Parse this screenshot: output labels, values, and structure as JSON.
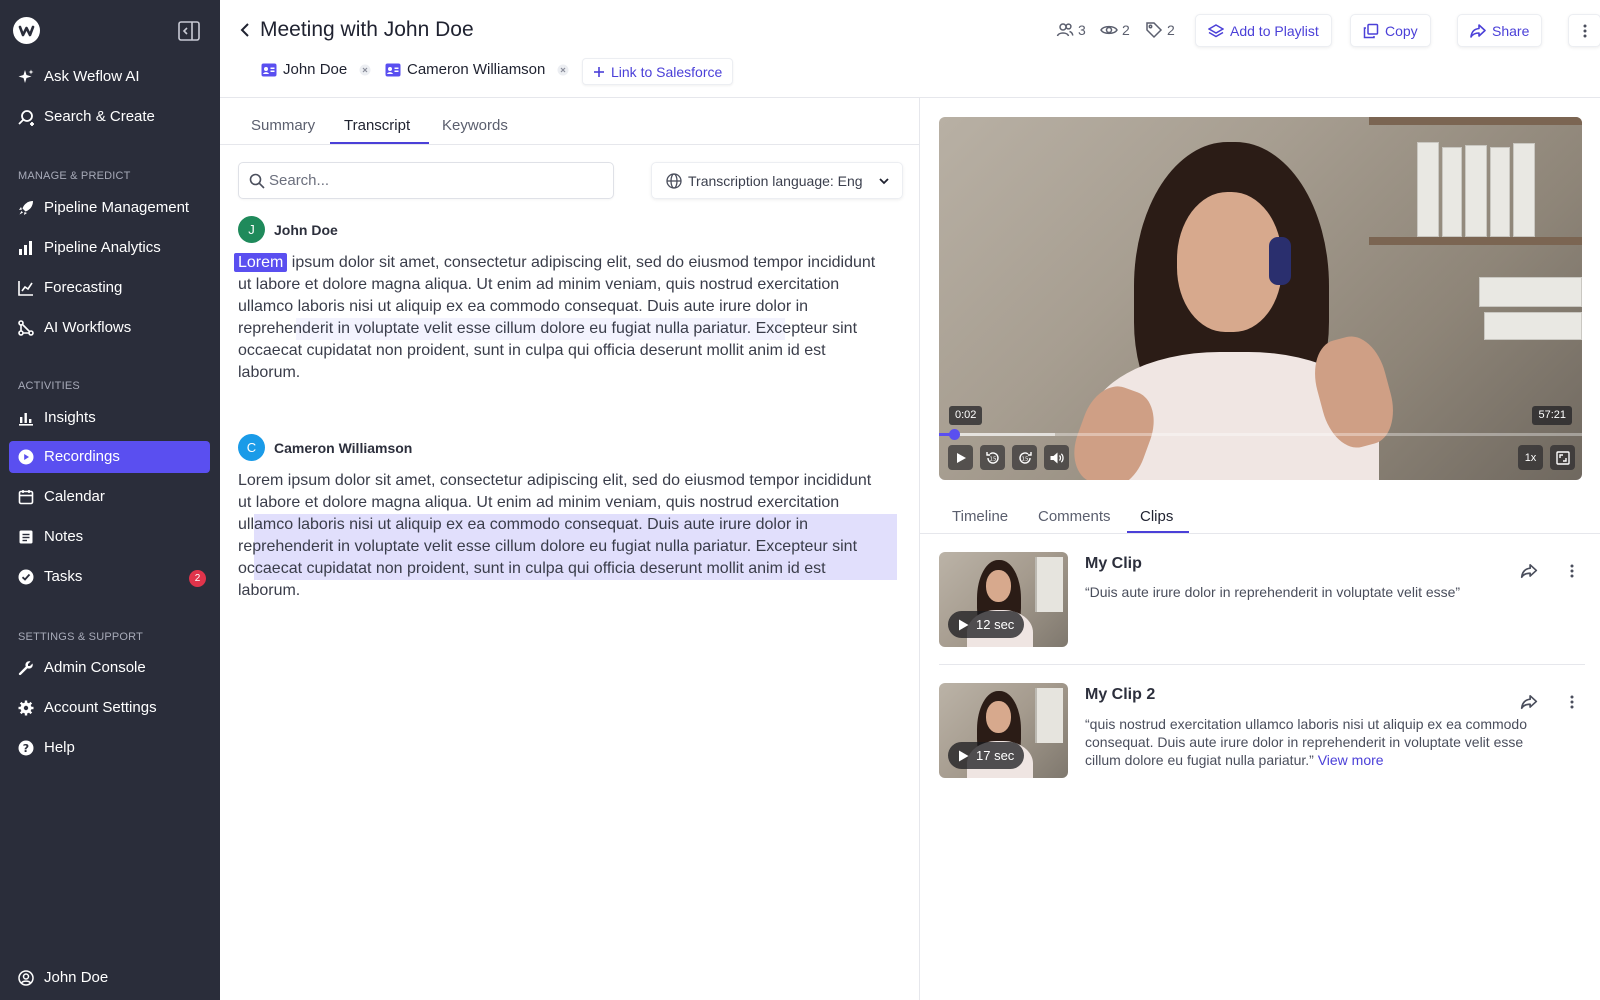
{
  "sidebar": {
    "top_items": [
      {
        "label": "Ask Weflow AI",
        "icon": "sparkle-icon"
      },
      {
        "label": "Search & Create",
        "icon": "search-plus-icon"
      }
    ],
    "sections": [
      {
        "title": "MANAGE & PREDICT",
        "items": [
          {
            "label": "Pipeline Management",
            "icon": "rocket-icon"
          },
          {
            "label": "Pipeline Analytics",
            "icon": "bar-chart-icon"
          },
          {
            "label": "Forecasting",
            "icon": "trend-chart-icon"
          },
          {
            "label": "AI Workflows",
            "icon": "workflow-icon"
          }
        ]
      },
      {
        "title": "ACTIVITIES",
        "items": [
          {
            "label": "Insights",
            "icon": "insights-chart-icon"
          },
          {
            "label": "Recordings",
            "icon": "play-circle-icon",
            "active": true
          },
          {
            "label": "Calendar",
            "icon": "calendar-icon"
          },
          {
            "label": "Notes",
            "icon": "note-icon"
          },
          {
            "label": "Tasks",
            "icon": "check-circle-icon",
            "badge": "2"
          }
        ]
      },
      {
        "title": "SETTINGS & SUPPORT",
        "items": [
          {
            "label": "Admin Console",
            "icon": "wrench-icon"
          },
          {
            "label": "Account Settings",
            "icon": "gear-icon"
          },
          {
            "label": "Help",
            "icon": "help-circle-icon"
          }
        ]
      }
    ],
    "user": {
      "label": "John Doe",
      "icon": "user-circle-icon"
    }
  },
  "header": {
    "title": "Meeting with John Doe",
    "participants": [
      {
        "name": "John Doe"
      },
      {
        "name": "Cameron Williamson"
      }
    ],
    "link_salesforce": "Link to Salesforce",
    "stats": {
      "participants": "3",
      "views": "2",
      "tags": "2"
    },
    "buttons": {
      "playlist": "Add to Playlist",
      "copy": "Copy",
      "share": "Share"
    }
  },
  "tabs": {
    "items": [
      "Summary",
      "Transcript",
      "Keywords"
    ],
    "active": "Transcript"
  },
  "search": {
    "placeholder": "Search...",
    "value": ""
  },
  "language": {
    "label": "Transcription language: Eng"
  },
  "transcript": [
    {
      "speaker": "John Doe",
      "initial": "J",
      "color": "#1f8a5b",
      "highlight_word": "Lorem",
      "text_rest": " ipsum dolor sit amet, consectetur adipiscing elit, sed do eiusmod tempor incididunt ut labore et dolore magna aliqua. Ut enim ad minim veniam, quis nostrud exercitation ullamco laboris nisi ut aliquip ex ea commodo consequat. Duis aute irure dolor in reprehenderit in voluptate velit esse cillum dolore eu fugiat nulla pariatur. Excepteur sint occaecat cupidatat non proident, sunt in culpa qui officia deserunt mollit anim id est laborum."
    },
    {
      "speaker": "Cameron Williamson",
      "initial": "C",
      "color": "#1a9be8",
      "text": "Lorem ipsum dolor sit amet, consectetur adipiscing elit, sed do eiusmod tempor incididunt ut labore et dolore magna aliqua. Ut enim ad minim veniam, quis nostrud exercitation ullamco laboris nisi ut aliquip ex ea commodo consequat. Duis aute irure dolor in reprehenderit in voluptate velit esse cillum dolore eu fugiat nulla pariatur. Excepteur sint occaecat cupidatat non proident, sunt in culpa qui officia deserunt mollit anim id est laborum."
    }
  ],
  "video": {
    "current_time": "0:02",
    "duration": "57:21",
    "progress": 0.003,
    "buffered": 0.18,
    "speed": "1x"
  },
  "right_tabs": {
    "items": [
      "Timeline",
      "Comments",
      "Clips"
    ],
    "active": "Clips"
  },
  "clips": [
    {
      "title": "My Clip",
      "duration": "12 sec",
      "quote": "“Duis aute irure dolor in reprehenderit in voluptate velit esse”",
      "view_more": ""
    },
    {
      "title": "My Clip 2",
      "duration": "17 sec",
      "quote": "“quis nostrud exercitation ullamco laboris nisi ut aliquip ex ea commodo consequat. Duis aute irure dolor in reprehenderit in voluptate velit esse cillum dolore eu fugiat nulla pariatur.”",
      "view_more": "View more"
    }
  ],
  "colors": {
    "accent": "#5a4ff0",
    "sidebar_bg": "#2a2d3a",
    "badge": "#e0344b"
  }
}
